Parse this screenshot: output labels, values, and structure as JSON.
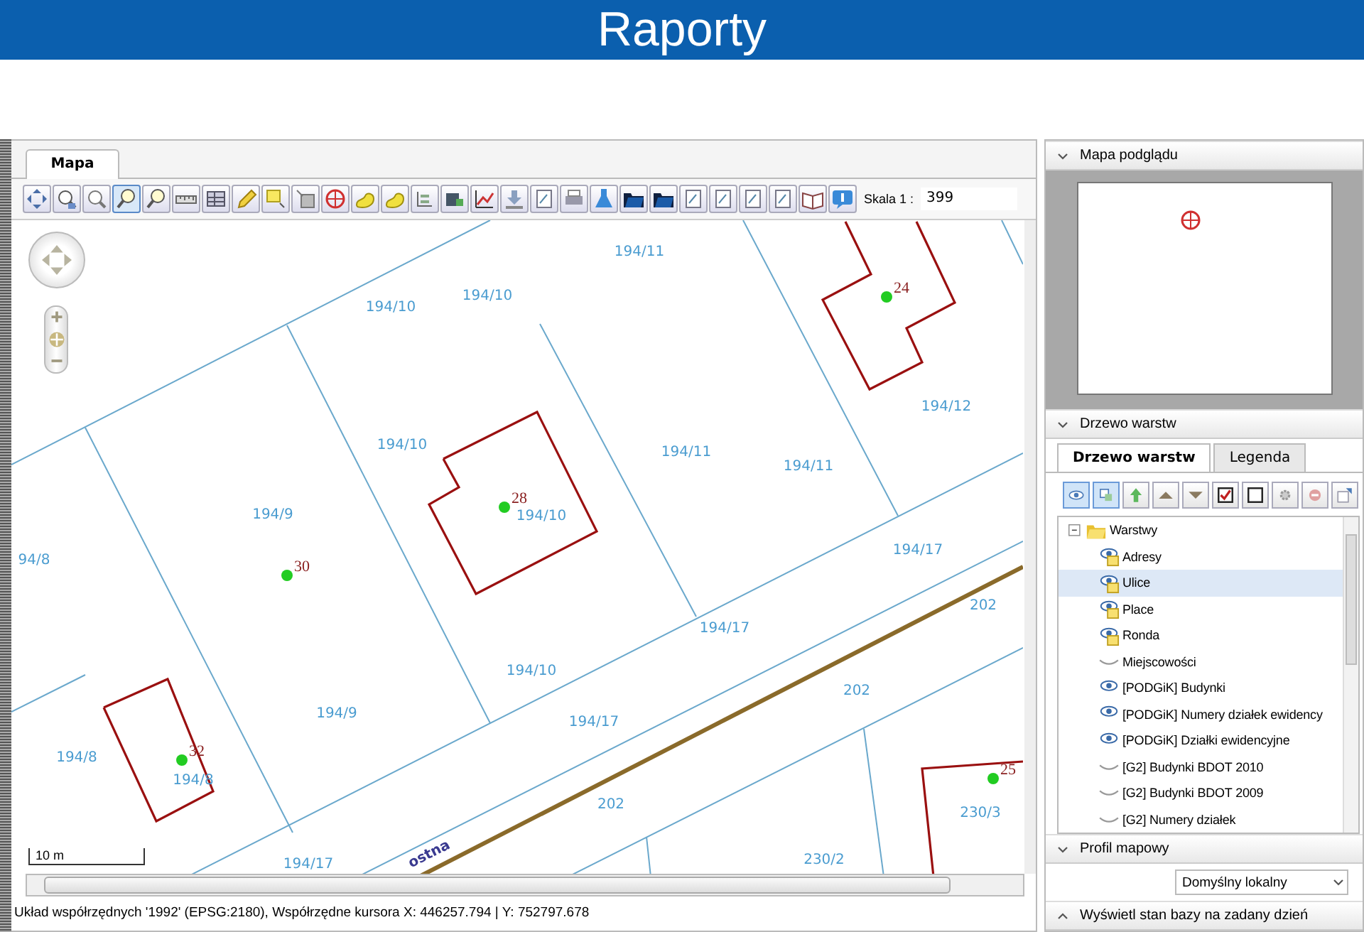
{
  "header": {
    "title": "Raporty"
  },
  "map_panel": {
    "tabs": [
      {
        "label": "Mapa",
        "selected": true
      }
    ],
    "tools": [
      {
        "selected": false
      },
      {
        "selected": false
      },
      {
        "selected": false
      },
      {
        "selected": true
      },
      {
        "selected": false
      },
      {
        "selected": false
      },
      {
        "selected": false
      },
      {
        "selected": false
      },
      {
        "selected": false
      },
      {
        "selected": false
      },
      {
        "selected": false
      },
      {
        "selected": false
      },
      {
        "selected": false
      },
      {
        "selected": false
      },
      {
        "selected": false
      },
      {
        "selected": false
      },
      {
        "selected": false
      },
      {
        "selected": false
      },
      {
        "selected": false
      },
      {
        "selected": false
      },
      {
        "selected": false
      },
      {
        "selected": false
      },
      {
        "selected": false
      },
      {
        "selected": false
      },
      {
        "selected": false
      },
      {
        "selected": false
      },
      {
        "selected": false
      },
      {
        "selected": false
      }
    ],
    "scale_label": "Skala 1 :",
    "scale_value": "399",
    "parcel_labels": [
      "194/11",
      "194/10",
      "194/10",
      "194/10",
      "194/9",
      "94/8",
      "194/11",
      "194/11",
      "194/12",
      "194/10",
      "194/17",
      "194/17",
      "202",
      "194/10",
      "202",
      "194/9",
      "194/17",
      "194/8",
      "194/8",
      "202",
      "230/3",
      "194/17",
      "230/2"
    ],
    "house_numbers": [
      "30",
      "28",
      "24",
      "32",
      "25"
    ],
    "street_label": "ostna",
    "scale_bar": "10 m",
    "zoom": {
      "level": 0.5
    },
    "status": "Układ współrzędnych '1992' (EPSG:2180), Współrzędne kursora X: 446257.794 | Y: 752797.678"
  },
  "side_panel": {
    "overview": {
      "title": "Mapa podglądu",
      "expanded": true
    },
    "layers": {
      "title": "Drzewo warstw",
      "expanded": true,
      "tabs": [
        {
          "label": "Drzewo warstw",
          "selected": true
        },
        {
          "label": "Legenda",
          "selected": false
        }
      ],
      "tools": [
        {
          "selected": true
        },
        {
          "selected": true
        },
        {
          "selected": false
        },
        {
          "selected": false
        },
        {
          "selected": false
        },
        {
          "selected": false
        },
        {
          "selected": false
        },
        {
          "selected": false
        },
        {
          "selected": false
        },
        {
          "selected": false
        }
      ],
      "tree": [
        {
          "label": "Warstwy",
          "kind": "folder",
          "expanded": true,
          "selected": false,
          "children": [
            {
              "label": "Adresy",
              "kind": "group",
              "visible": true,
              "selected": false
            },
            {
              "label": "Ulice",
              "kind": "group",
              "visible": true,
              "selected": true
            },
            {
              "label": "Place",
              "kind": "group",
              "visible": true,
              "selected": false
            },
            {
              "label": "Ronda",
              "kind": "group",
              "visible": true,
              "selected": false
            },
            {
              "label": "Miejscowości",
              "kind": "layer",
              "visible": false,
              "selected": false
            },
            {
              "label": "[PODGiK] Budynki",
              "kind": "layer",
              "visible": true,
              "selected": false
            },
            {
              "label": "[PODGiK] Numery działek ewidency",
              "kind": "layer",
              "visible": true,
              "selected": false
            },
            {
              "label": "[PODGiK] Działki ewidencyjne",
              "kind": "layer",
              "visible": true,
              "selected": false
            },
            {
              "label": "[G2] Budynki BDOT 2010",
              "kind": "layer",
              "visible": false,
              "selected": false
            },
            {
              "label": "[G2] Budynki BDOT 2009",
              "kind": "layer",
              "visible": false,
              "selected": false
            },
            {
              "label": "[G2] Numery działek",
              "kind": "layer",
              "visible": false,
              "selected": false
            }
          ]
        }
      ]
    },
    "profile": {
      "title": "Profil mapowy",
      "expanded": true,
      "value": "Domyślny lokalny"
    },
    "history": {
      "title": "Wyświetl stan bazy na zadany dzień",
      "expanded": false
    }
  }
}
